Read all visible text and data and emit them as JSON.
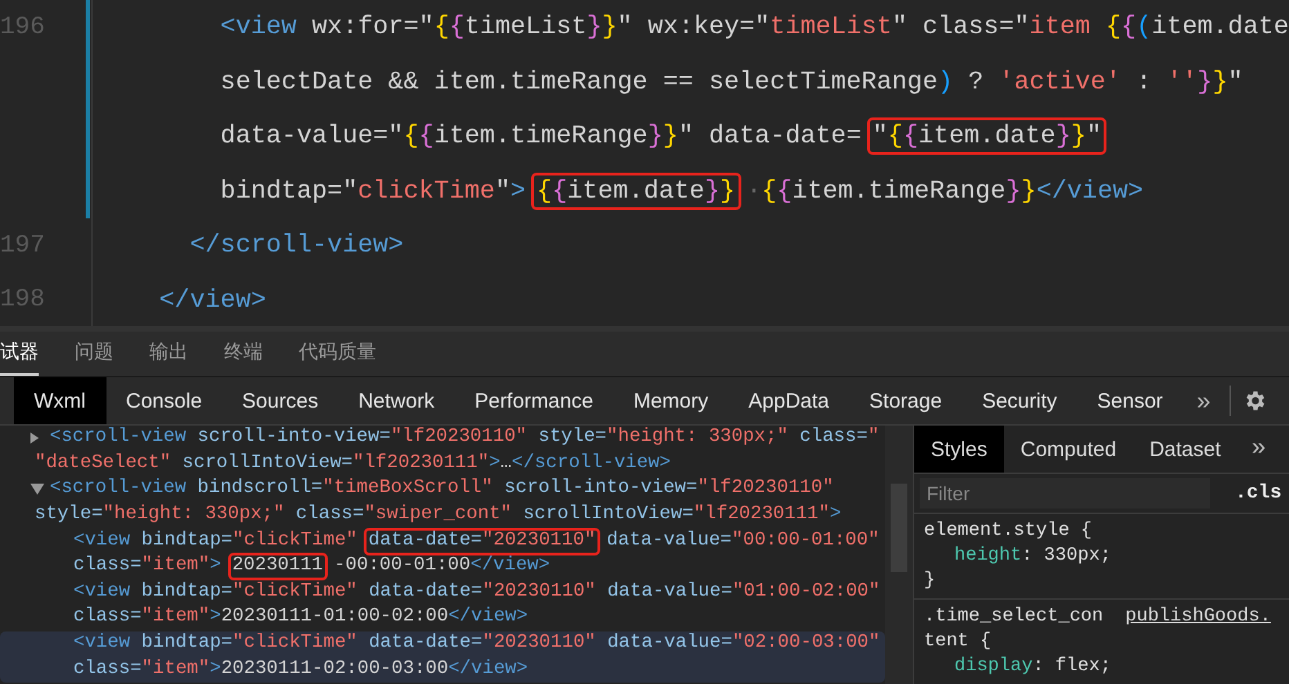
{
  "editor": {
    "lines": [
      {
        "number": "196",
        "rows": [
          {
            "parts": [
              {
                "boxed": false,
                "tokens": [
                  {
                    "kind": "tag",
                    "text": "        <view"
                  },
                  {
                    "kind": "plain",
                    "text": " wx:for=\""
                  },
                  {
                    "kind": "brace-outer",
                    "text": "{"
                  },
                  {
                    "kind": "brace-inner",
                    "text": "{"
                  },
                  {
                    "kind": "plain",
                    "text": "timeList"
                  },
                  {
                    "kind": "brace-inner",
                    "text": "}"
                  },
                  {
                    "kind": "brace-outer",
                    "text": "}"
                  },
                  {
                    "kind": "plain",
                    "text": "\" wx:key=\""
                  },
                  {
                    "kind": "str",
                    "text": "timeList"
                  },
                  {
                    "kind": "plain",
                    "text": "\" class=\""
                  },
                  {
                    "kind": "str",
                    "text": "item "
                  },
                  {
                    "kind": "brace-outer",
                    "text": "{"
                  },
                  {
                    "kind": "brace-inner",
                    "text": "{"
                  },
                  {
                    "kind": "paren",
                    "text": "("
                  },
                  {
                    "kind": "plain",
                    "text": "item.date"
                  }
                ]
              }
            ]
          },
          {
            "parts": [
              {
                "boxed": false,
                "tokens": [
                  {
                    "kind": "plain",
                    "text": "        selectDate && item.timeRange == selectTimeRange"
                  },
                  {
                    "kind": "paren",
                    "text": ")"
                  },
                  {
                    "kind": "plain",
                    "text": " ? "
                  },
                  {
                    "kind": "str",
                    "text": "'active'"
                  },
                  {
                    "kind": "plain",
                    "text": " : "
                  },
                  {
                    "kind": "str",
                    "text": "''"
                  },
                  {
                    "kind": "brace-inner",
                    "text": "}"
                  },
                  {
                    "kind": "brace-outer",
                    "text": "}"
                  },
                  {
                    "kind": "plain",
                    "text": "\""
                  }
                ]
              }
            ]
          },
          {
            "parts": [
              {
                "boxed": false,
                "tokens": [
                  {
                    "kind": "plain",
                    "text": "        data-value=\""
                  },
                  {
                    "kind": "brace-outer",
                    "text": "{"
                  },
                  {
                    "kind": "brace-inner",
                    "text": "{"
                  },
                  {
                    "kind": "plain",
                    "text": "item.timeRange"
                  },
                  {
                    "kind": "brace-inner",
                    "text": "}"
                  },
                  {
                    "kind": "brace-outer",
                    "text": "}"
                  },
                  {
                    "kind": "plain",
                    "text": "\" data-date="
                  }
                ]
              },
              {
                "boxed": true,
                "tokens": [
                  {
                    "kind": "plain",
                    "text": "\""
                  },
                  {
                    "kind": "brace-outer",
                    "text": "{"
                  },
                  {
                    "kind": "brace-inner",
                    "text": "{"
                  },
                  {
                    "kind": "plain",
                    "text": "item.date"
                  },
                  {
                    "kind": "brace-inner",
                    "text": "}"
                  },
                  {
                    "kind": "brace-outer",
                    "text": "}"
                  },
                  {
                    "kind": "plain",
                    "text": "\""
                  }
                ]
              }
            ]
          },
          {
            "parts": [
              {
                "boxed": false,
                "tokens": [
                  {
                    "kind": "plain",
                    "text": "        bindtap=\""
                  },
                  {
                    "kind": "str",
                    "text": "clickTime"
                  },
                  {
                    "kind": "plain",
                    "text": "\""
                  },
                  {
                    "kind": "tag",
                    "text": ">"
                  }
                ]
              },
              {
                "boxed": true,
                "tokens": [
                  {
                    "kind": "brace-outer",
                    "text": "{"
                  },
                  {
                    "kind": "brace-inner",
                    "text": "{"
                  },
                  {
                    "kind": "plain",
                    "text": "item.date"
                  },
                  {
                    "kind": "brace-inner",
                    "text": "}"
                  },
                  {
                    "kind": "brace-outer",
                    "text": "}"
                  }
                ]
              },
              {
                "boxed": false,
                "tokens": [
                  {
                    "kind": "whitespace",
                    "text": "·"
                  },
                  {
                    "kind": "brace-outer",
                    "text": "{"
                  },
                  {
                    "kind": "brace-inner",
                    "text": "{"
                  },
                  {
                    "kind": "plain",
                    "text": "item.timeRange"
                  },
                  {
                    "kind": "brace-inner",
                    "text": "}"
                  },
                  {
                    "kind": "brace-outer",
                    "text": "}"
                  },
                  {
                    "kind": "tag",
                    "text": "</view>"
                  }
                ]
              }
            ]
          }
        ]
      },
      {
        "number": "197",
        "rows": [
          {
            "parts": [
              {
                "boxed": false,
                "tokens": [
                  {
                    "kind": "tag",
                    "text": "      </scroll-view>"
                  }
                ]
              }
            ]
          }
        ]
      },
      {
        "number": "198",
        "rows": [
          {
            "parts": [
              {
                "boxed": false,
                "tokens": [
                  {
                    "kind": "tag",
                    "text": "    </view>"
                  }
                ]
              }
            ]
          }
        ]
      }
    ]
  },
  "panel_tabs": [
    {
      "label": "试器",
      "selected": true
    },
    {
      "label": "问题",
      "selected": false
    },
    {
      "label": "输出",
      "selected": false
    },
    {
      "label": "终端",
      "selected": false
    },
    {
      "label": "代码质量",
      "selected": false
    }
  ],
  "devtools_tabs": [
    {
      "label": "Wxml",
      "selected": true
    },
    {
      "label": "Console",
      "selected": false
    },
    {
      "label": "Sources",
      "selected": false
    },
    {
      "label": "Network",
      "selected": false
    },
    {
      "label": "Performance",
      "selected": false
    },
    {
      "label": "Memory",
      "selected": false
    },
    {
      "label": "AppData",
      "selected": false
    },
    {
      "label": "Storage",
      "selected": false
    },
    {
      "label": "Security",
      "selected": false
    },
    {
      "label": "Sensor",
      "selected": false
    }
  ],
  "devtools_more": "»",
  "wxml_tree": [
    {
      "expanded": false,
      "lines": [
        {
          "parts": [
            {
              "boxed": false,
              "tokens": [
                {
                  "kind": "tag",
                  "text": "<scroll-view"
                },
                {
                  "kind": "attr",
                  "text": " scroll-into-view="
                },
                {
                  "kind": "str",
                  "text": "\"lf20230110\""
                },
                {
                  "kind": "attr",
                  "text": " style="
                },
                {
                  "kind": "str",
                  "text": "\"height: 330px;\""
                },
                {
                  "kind": "attr",
                  "text": " class="
                },
                {
                  "kind": "str",
                  "text": "\""
                }
              ]
            }
          ]
        },
        {
          "parts": [
            {
              "boxed": false,
              "tokens": [
                {
                  "kind": "str",
                  "text": "\"dateSelect\""
                },
                {
                  "kind": "attr",
                  "text": " scrollIntoView="
                },
                {
                  "kind": "str",
                  "text": "\"lf20230111\""
                },
                {
                  "kind": "tag",
                  "text": ">"
                },
                {
                  "kind": "plain",
                  "text": "…"
                },
                {
                  "kind": "tag",
                  "text": "</scroll-view>"
                }
              ]
            }
          ]
        }
      ]
    },
    {
      "expanded": true,
      "lines": [
        {
          "parts": [
            {
              "boxed": false,
              "tokens": [
                {
                  "kind": "tag",
                  "text": "<scroll-view"
                },
                {
                  "kind": "attr",
                  "text": " bindscroll="
                },
                {
                  "kind": "str",
                  "text": "\"timeBoxScroll\""
                },
                {
                  "kind": "attr",
                  "text": " scroll-into-view="
                },
                {
                  "kind": "str",
                  "text": "\"lf20230110\""
                }
              ]
            }
          ]
        },
        {
          "parts": [
            {
              "boxed": false,
              "tokens": [
                {
                  "kind": "attr",
                  "text": "style="
                },
                {
                  "kind": "str",
                  "text": "\"height: 330px;\""
                },
                {
                  "kind": "attr",
                  "text": " class="
                },
                {
                  "kind": "str",
                  "text": "\"swiper_cont\""
                },
                {
                  "kind": "attr",
                  "text": " scrollIntoView="
                },
                {
                  "kind": "str",
                  "text": "\"lf20230111\""
                },
                {
                  "kind": "tag",
                  "text": ">"
                }
              ]
            }
          ]
        }
      ],
      "children": [
        {
          "highlighted": false,
          "lines": [
            {
              "parts": [
                {
                  "boxed": false,
                  "tokens": [
                    {
                      "kind": "tag",
                      "text": "<view"
                    },
                    {
                      "kind": "attr",
                      "text": " bindtap="
                    },
                    {
                      "kind": "str",
                      "text": "\"clickTime\""
                    }
                  ]
                },
                {
                  "boxed": true,
                  "tokens": [
                    {
                      "kind": "attr",
                      "text": "data-date="
                    },
                    {
                      "kind": "str",
                      "text": "\"20230110\""
                    }
                  ]
                },
                {
                  "boxed": false,
                  "tokens": [
                    {
                      "kind": "attr",
                      "text": "data-value="
                    },
                    {
                      "kind": "str",
                      "text": "\"00:00-01:00\""
                    }
                  ]
                }
              ]
            },
            {
              "parts": [
                {
                  "boxed": false,
                  "tokens": [
                    {
                      "kind": "attr",
                      "text": "class="
                    },
                    {
                      "kind": "str",
                      "text": "\"item\""
                    },
                    {
                      "kind": "tag",
                      "text": ">"
                    }
                  ]
                },
                {
                  "boxed": true,
                  "tokens": [
                    {
                      "kind": "plain",
                      "text": "20230111"
                    }
                  ]
                },
                {
                  "boxed": false,
                  "tokens": [
                    {
                      "kind": "plain",
                      "text": "-00:00-01:00"
                    },
                    {
                      "kind": "tag",
                      "text": "</view>"
                    }
                  ]
                }
              ]
            }
          ]
        },
        {
          "highlighted": false,
          "lines": [
            {
              "parts": [
                {
                  "boxed": false,
                  "tokens": [
                    {
                      "kind": "tag",
                      "text": "<view"
                    },
                    {
                      "kind": "attr",
                      "text": " bindtap="
                    },
                    {
                      "kind": "str",
                      "text": "\"clickTime\""
                    },
                    {
                      "kind": "attr",
                      "text": " data-date="
                    },
                    {
                      "kind": "str",
                      "text": "\"20230110\""
                    },
                    {
                      "kind": "attr",
                      "text": " data-value="
                    },
                    {
                      "kind": "str",
                      "text": "\"01:00-02:00\""
                    }
                  ]
                }
              ]
            },
            {
              "parts": [
                {
                  "boxed": false,
                  "tokens": [
                    {
                      "kind": "attr",
                      "text": "class="
                    },
                    {
                      "kind": "str",
                      "text": "\"item\""
                    },
                    {
                      "kind": "tag",
                      "text": ">"
                    },
                    {
                      "kind": "plain",
                      "text": "20230111-01:00-02:00"
                    },
                    {
                      "kind": "tag",
                      "text": "</view>"
                    }
                  ]
                }
              ]
            }
          ]
        },
        {
          "highlighted": true,
          "lines": [
            {
              "parts": [
                {
                  "boxed": false,
                  "tokens": [
                    {
                      "kind": "tag",
                      "text": "<view"
                    },
                    {
                      "kind": "attr",
                      "text": " bindtap="
                    },
                    {
                      "kind": "str",
                      "text": "\"clickTime\""
                    },
                    {
                      "kind": "attr",
                      "text": " data-date="
                    },
                    {
                      "kind": "str",
                      "text": "\"20230110\""
                    },
                    {
                      "kind": "attr",
                      "text": " data-value="
                    },
                    {
                      "kind": "str",
                      "text": "\"02:00-03:00\""
                    }
                  ]
                }
              ]
            },
            {
              "parts": [
                {
                  "boxed": false,
                  "tokens": [
                    {
                      "kind": "attr",
                      "text": "class="
                    },
                    {
                      "kind": "str",
                      "text": "\"item\""
                    },
                    {
                      "kind": "tag",
                      "text": ">"
                    },
                    {
                      "kind": "plain",
                      "text": "20230111-02:00-03:00"
                    },
                    {
                      "kind": "tag",
                      "text": "</view>"
                    }
                  ]
                }
              ]
            }
          ]
        }
      ]
    }
  ],
  "styles_panel": {
    "tabs": [
      {
        "label": "Styles",
        "selected": true
      },
      {
        "label": "Computed",
        "selected": false
      },
      {
        "label": "Dataset",
        "selected": false
      }
    ],
    "more": "»",
    "filter": {
      "placeholder": "Filter"
    },
    "cls_button": ".cls",
    "rules": [
      {
        "selector_lines": [
          "element.style {"
        ],
        "declarations": [
          {
            "property": "height",
            "rest": ": 330px;"
          }
        ],
        "close": "}"
      },
      {
        "selector_lines": [
          ".time_select_con",
          "tent {"
        ],
        "source": "publishGoods.",
        "declarations": [
          {
            "property": "display",
            "rest": ": flex;"
          }
        ]
      }
    ]
  }
}
